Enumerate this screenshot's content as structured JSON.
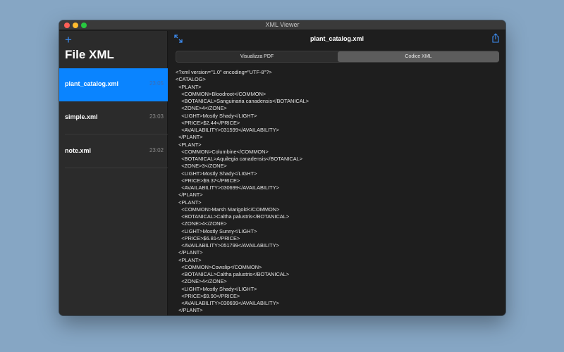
{
  "window": {
    "title": "XML Viewer"
  },
  "sidebar": {
    "add_icon": "plus-icon",
    "add_label": "+",
    "title": "File XML",
    "files": [
      {
        "name": "plant_catalog.xml",
        "time": "23:05",
        "selected": true
      },
      {
        "name": "simple.xml",
        "time": "23:03",
        "selected": false
      },
      {
        "name": "note.xml",
        "time": "23:02",
        "selected": false
      }
    ]
  },
  "toolbar": {
    "expand_icon": "expand-icon",
    "document_title": "plant_catalog.xml",
    "share_icon": "share-icon"
  },
  "segments": {
    "items": [
      "Visualizza PDF",
      "Codice XML"
    ],
    "selected": "Codice XML"
  },
  "code": {
    "lines": [
      "<?xml version=\"1.0\" encoding=\"UTF-8\"?>",
      "<CATALOG>",
      "  <PLANT>",
      "    <COMMON>Bloodroot</COMMON>",
      "    <BOTANICAL>Sanguinaria canadensis</BOTANICAL>",
      "    <ZONE>4</ZONE>",
      "    <LIGHT>Mostly Shady</LIGHT>",
      "    <PRICE>$2.44</PRICE>",
      "    <AVAILABILITY>031599</AVAILABILITY>",
      "  </PLANT>",
      "  <PLANT>",
      "    <COMMON>Columbine</COMMON>",
      "    <BOTANICAL>Aquilegia canadensis</BOTANICAL>",
      "    <ZONE>3</ZONE>",
      "    <LIGHT>Mostly Shady</LIGHT>",
      "    <PRICE>$9.37</PRICE>",
      "    <AVAILABILITY>030699</AVAILABILITY>",
      "  </PLANT>",
      "  <PLANT>",
      "    <COMMON>Marsh Marigold</COMMON>",
      "    <BOTANICAL>Caltha palustris</BOTANICAL>",
      "    <ZONE>4</ZONE>",
      "    <LIGHT>Mostly Sunny</LIGHT>",
      "    <PRICE>$6.81</PRICE>",
      "    <AVAILABILITY>051799</AVAILABILITY>",
      "  </PLANT>",
      "  <PLANT>",
      "    <COMMON>Cowslip</COMMON>",
      "    <BOTANICAL>Caltha palustris</BOTANICAL>",
      "    <ZONE>4</ZONE>",
      "    <LIGHT>Mostly Shady</LIGHT>",
      "    <PRICE>$9.90</PRICE>",
      "    <AVAILABILITY>030699</AVAILABILITY>",
      "  </PLANT>"
    ]
  },
  "colors": {
    "accent": "#0a84ff",
    "add_icon": "#3d8ef4",
    "desktop": "#86a6c4"
  }
}
